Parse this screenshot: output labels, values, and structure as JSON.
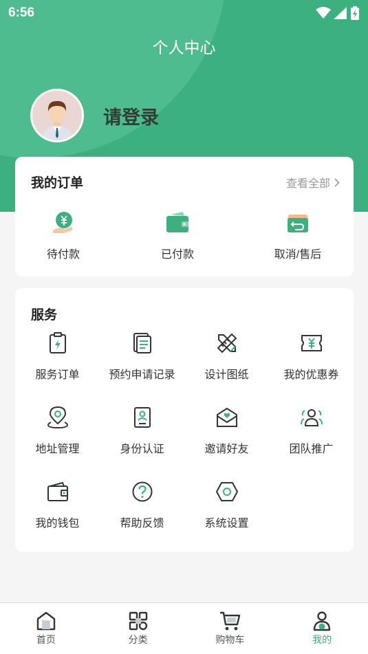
{
  "status_bar": {
    "time": "6:56"
  },
  "header": {
    "title": "个人中心"
  },
  "profile": {
    "login_prompt": "请登录"
  },
  "orders": {
    "title": "我的订单",
    "view_all": "查看全部",
    "items": [
      {
        "label": "待付款",
        "icon": "yuan-hand-icon"
      },
      {
        "label": "已付款",
        "icon": "wallet-icon"
      },
      {
        "label": "取消/售后",
        "icon": "return-box-icon"
      }
    ]
  },
  "services": {
    "title": "服务",
    "items": [
      {
        "label": "服务订单",
        "icon": "clipboard-bolt-icon"
      },
      {
        "label": "预约申请记录",
        "icon": "document-icon"
      },
      {
        "label": "设计图纸",
        "icon": "pencil-ruler-icon"
      },
      {
        "label": "我的优惠券",
        "icon": "coupon-icon"
      },
      {
        "label": "地址管理",
        "icon": "location-pin-icon"
      },
      {
        "label": "身份认证",
        "icon": "id-card-icon"
      },
      {
        "label": "邀请好友",
        "icon": "invite-mail-icon"
      },
      {
        "label": "团队推广",
        "icon": "team-icon"
      },
      {
        "label": "我的钱包",
        "icon": "wallet-icon"
      },
      {
        "label": "帮助反馈",
        "icon": "help-icon"
      },
      {
        "label": "系统设置",
        "icon": "settings-hexagon-icon"
      }
    ]
  },
  "tabbar": {
    "tabs": [
      {
        "label": "首页",
        "icon": "home-icon"
      },
      {
        "label": "分类",
        "icon": "grid-icon"
      },
      {
        "label": "购物车",
        "icon": "cart-icon"
      },
      {
        "label": "我的",
        "icon": "user-icon",
        "active": true
      }
    ]
  },
  "colors": {
    "primary": "#3db080",
    "text": "#333333",
    "muted": "#999999"
  }
}
